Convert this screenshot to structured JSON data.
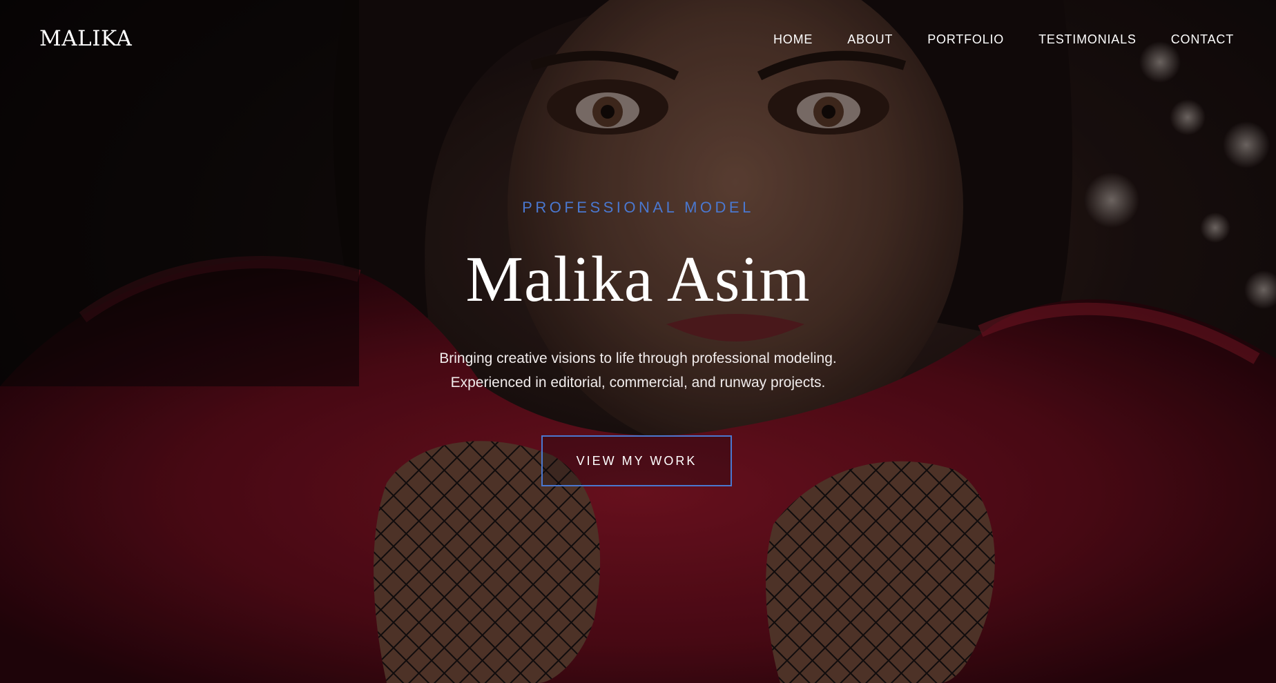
{
  "brand": {
    "logo_text": "MALIKA"
  },
  "nav": {
    "items": [
      {
        "label": "HOME"
      },
      {
        "label": "ABOUT"
      },
      {
        "label": "PORTFOLIO"
      },
      {
        "label": "TESTIMONIALS"
      },
      {
        "label": "CONTACT"
      }
    ]
  },
  "hero": {
    "eyebrow": "PROFESSIONAL MODEL",
    "title": "Malika Asim",
    "subtitle_line1": "Bringing creative visions to life through professional modeling.",
    "subtitle_line2": "Experienced in editorial, commercial, and runway projects.",
    "cta_label": "VIEW MY WORK"
  },
  "colors": {
    "accent": "#4a78d0",
    "text_primary": "#ffffff",
    "fur": "#6e0f1d",
    "background": "#0b0708"
  }
}
